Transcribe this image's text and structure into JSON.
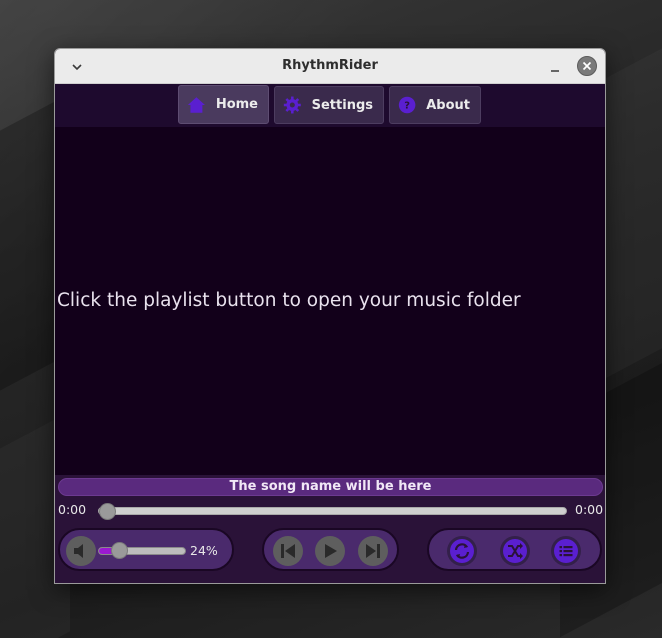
{
  "window": {
    "title": "RhythmRider"
  },
  "nav": {
    "items": [
      {
        "label": "Home",
        "icon": "home-icon"
      },
      {
        "label": "Settings",
        "icon": "gear-icon"
      },
      {
        "label": "About",
        "icon": "question-icon"
      }
    ],
    "active": "Home"
  },
  "content": {
    "message": "Click the playlist button to open your music folder"
  },
  "player": {
    "song_name": "The song name will be here",
    "elapsed": "0:00",
    "duration": "0:00",
    "seek_fraction": 0,
    "volume_percent": 24,
    "volume_label": "24%"
  },
  "colors": {
    "accent": "#5a1fd0",
    "background": "#12001a",
    "player_bg": "#2a1238",
    "pill_bg": "#4a2a6c",
    "volume_fill": "#9a1ad0"
  }
}
